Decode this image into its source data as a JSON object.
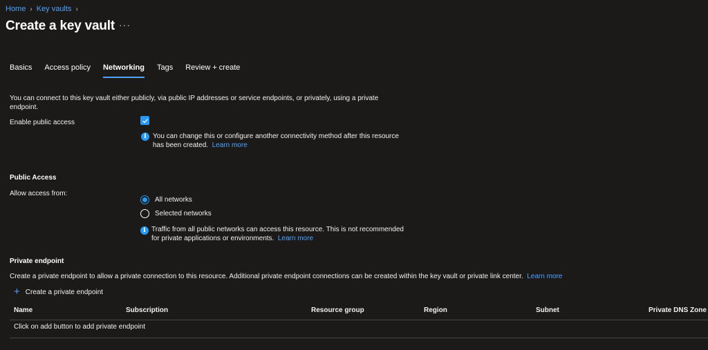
{
  "breadcrumb": {
    "home": "Home",
    "key_vaults": "Key vaults"
  },
  "page": {
    "title": "Create a key vault",
    "more": "···"
  },
  "tabs": [
    {
      "label": "Basics"
    },
    {
      "label": "Access policy"
    },
    {
      "label": "Networking"
    },
    {
      "label": "Tags"
    },
    {
      "label": "Review + create"
    }
  ],
  "networking": {
    "intro": "You can connect to this key vault either publicly, via public IP addresses or service endpoints, or privately, using a private endpoint.",
    "enable_public_access_label": "Enable public access",
    "enable_public_access_checked": true,
    "public_info_text": "You can change this or configure another connectivity method after this resource has been created.",
    "learn_more": "Learn more"
  },
  "public_access": {
    "title": "Public Access",
    "allow_label": "Allow access from:",
    "options": [
      {
        "label": "All networks",
        "checked": true
      },
      {
        "label": "Selected networks",
        "checked": false
      }
    ],
    "info_text": "Traffic from all public networks can access this resource. This is not recommended for private applications or environments.",
    "learn_more": "Learn more"
  },
  "private_endpoint": {
    "title": "Private endpoint",
    "description": "Create a private endpoint to allow a private connection to this resource. Additional private endpoint connections can be created within the key vault or private link center.",
    "learn_more": "Learn more",
    "add_label": "Create a private endpoint",
    "columns": [
      "Name",
      "Subscription",
      "Resource group",
      "Region",
      "Subnet",
      "Private DNS Zone"
    ],
    "empty_text": "Click on add button to add private endpoint"
  },
  "colors": {
    "accent": "#2899f5",
    "link": "#4da3ff",
    "background": "#1b1a19"
  }
}
